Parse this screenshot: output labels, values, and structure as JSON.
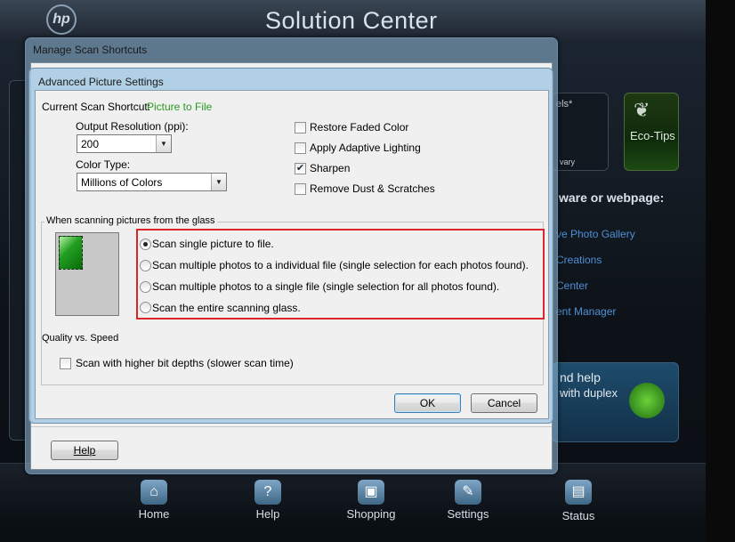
{
  "app": {
    "title": "Solution Center",
    "logo_text": "hp",
    "tile_pixels_text": "els*",
    "tile_vary_text": "vary",
    "eco_tips_label": "Eco-Tips",
    "section_heading": "ware or webpage:",
    "links": [
      "ve Photo Gallery",
      "Creations",
      "Center",
      "ent Manager"
    ],
    "promo_line1": "nd help",
    "promo_line2": "with duplex",
    "taskbar": [
      {
        "label": "Home",
        "icon": "home-icon"
      },
      {
        "label": "Help",
        "icon": "help-icon"
      },
      {
        "label": "Shopping",
        "icon": "shopping-cart-icon"
      },
      {
        "label": "Settings",
        "icon": "wrench-icon"
      },
      {
        "label": "Status",
        "icon": "status-icon"
      }
    ]
  },
  "outer_dialog": {
    "title": "Manage Scan Shortcuts",
    "help_button": "Help"
  },
  "inner_dialog": {
    "title": "Advanced Picture Settings",
    "current_shortcut_label": "Current Scan Shortcut:",
    "current_shortcut_value": "Picture to File",
    "resolution_label": "Output Resolution (ppi):",
    "resolution_value": "200",
    "color_type_label": "Color Type:",
    "color_type_value": "Millions of Colors",
    "options": [
      {
        "label": "Restore Faded Color",
        "checked": false
      },
      {
        "label": "Apply Adaptive Lighting",
        "checked": false
      },
      {
        "label": "Sharpen",
        "checked": true
      },
      {
        "label": "Remove Dust & Scratches",
        "checked": false
      }
    ],
    "glass_group_label": "When scanning pictures from the glass",
    "scan_modes": [
      {
        "label": "Scan single picture to file.",
        "selected": true
      },
      {
        "label": "Scan multiple photos to a individual file (single selection for each photos found).",
        "selected": false
      },
      {
        "label": "Scan multiple photos to a single file (single selection for all photos found).",
        "selected": false
      },
      {
        "label": "Scan the entire scanning glass.",
        "selected": false
      }
    ],
    "quality_label": "Quality vs. Speed",
    "bit_depth_label": "Scan with higher bit depths (slower scan time)",
    "bit_depth_checked": false,
    "ok_button": "OK",
    "cancel_button": "Cancel"
  },
  "colors": {
    "highlight": "#d8262a",
    "shortcut_value": "#2a9a22"
  }
}
